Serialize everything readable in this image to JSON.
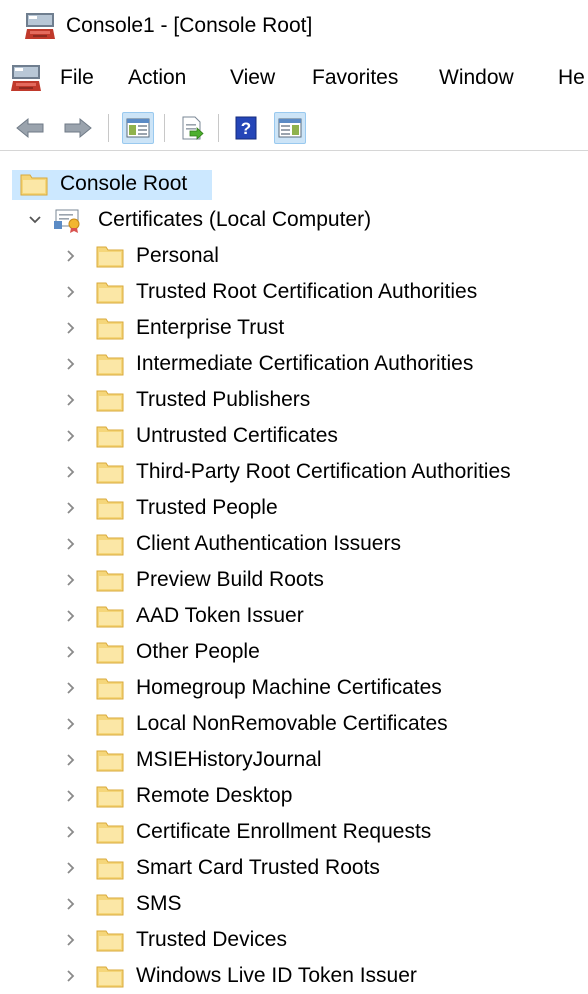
{
  "window": {
    "title": "Console1 - [Console Root]"
  },
  "menu": {
    "items": [
      "File",
      "Action",
      "View",
      "Favorites",
      "Window",
      "He"
    ]
  },
  "toolbar": {
    "buttons": [
      "back-icon",
      "forward-icon",
      "show-hide-console-tree-icon",
      "export-list-icon",
      "help-icon",
      "show-hide-action-pane-icon"
    ]
  },
  "tree": {
    "root": "Console Root",
    "snapin": "Certificates (Local Computer)",
    "children": [
      "Personal",
      "Trusted Root Certification Authorities",
      "Enterprise Trust",
      "Intermediate Certification Authorities",
      "Trusted Publishers",
      "Untrusted Certificates",
      "Third-Party Root Certification Authorities",
      "Trusted People",
      "Client Authentication Issuers",
      "Preview Build Roots",
      "AAD Token Issuer",
      "Other People",
      "Homegroup Machine Certificates",
      "Local NonRemovable Certificates",
      "MSIEHistoryJournal",
      "Remote Desktop",
      "Certificate Enrollment Requests",
      "Smart Card Trusted Roots",
      "SMS",
      "Trusted Devices",
      "Windows Live ID Token Issuer"
    ]
  },
  "colors": {
    "selection": "#cce8ff",
    "folder": "#f5d67a",
    "folder_edge": "#d9a93a",
    "chevron": "#8a8a8a"
  }
}
